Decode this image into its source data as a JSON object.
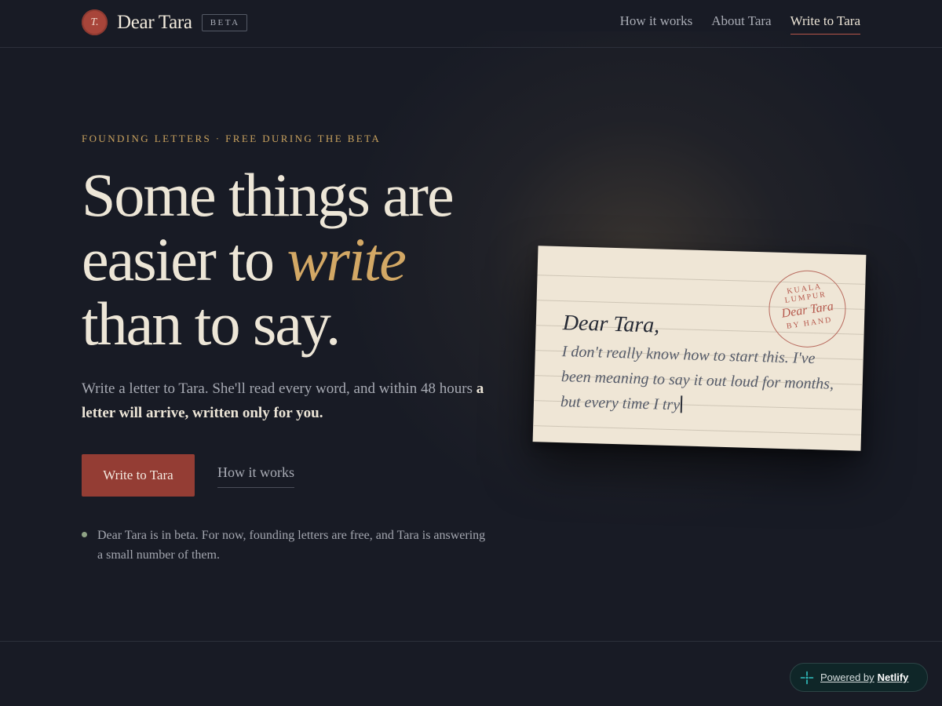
{
  "brand": {
    "seal_letter": "T.",
    "name": "Dear Tara",
    "badge": "BETA"
  },
  "nav": {
    "items": [
      {
        "label": "How it works"
      },
      {
        "label": "About Tara"
      },
      {
        "label": "Write to Tara"
      }
    ]
  },
  "hero": {
    "eyebrow": "FOUNDING LETTERS · FREE DURING THE BETA",
    "headline_part1": "Some things are easier to ",
    "headline_emphasis": "write",
    "headline_part2": " than to say.",
    "lede_plain": "Write a letter to Tara. She'll read every word, and within 48 hours ",
    "lede_bold": "a letter will arrive, written only for you.",
    "cta_label": "Write to Tara",
    "secondary_label": "How it works",
    "note": "Dear Tara is in beta. For now, founding letters are free, and Tara is answering a small number of them."
  },
  "letter": {
    "stamp_top": "KUALA LUMPUR",
    "stamp_middle": "Dear Tara",
    "stamp_bottom": "BY HAND",
    "salutation": "Dear Tara,",
    "body": "I don't really know how to start this. I've been meaning to say it out loud for months, but every time I try"
  },
  "footer": {
    "badge_prefix": "Powered by",
    "badge_brand": "Netlify"
  },
  "colors": {
    "background": "#181b25",
    "accent_gold": "#d3a865",
    "accent_red": "#943d34",
    "paper": "#efe6d6"
  }
}
